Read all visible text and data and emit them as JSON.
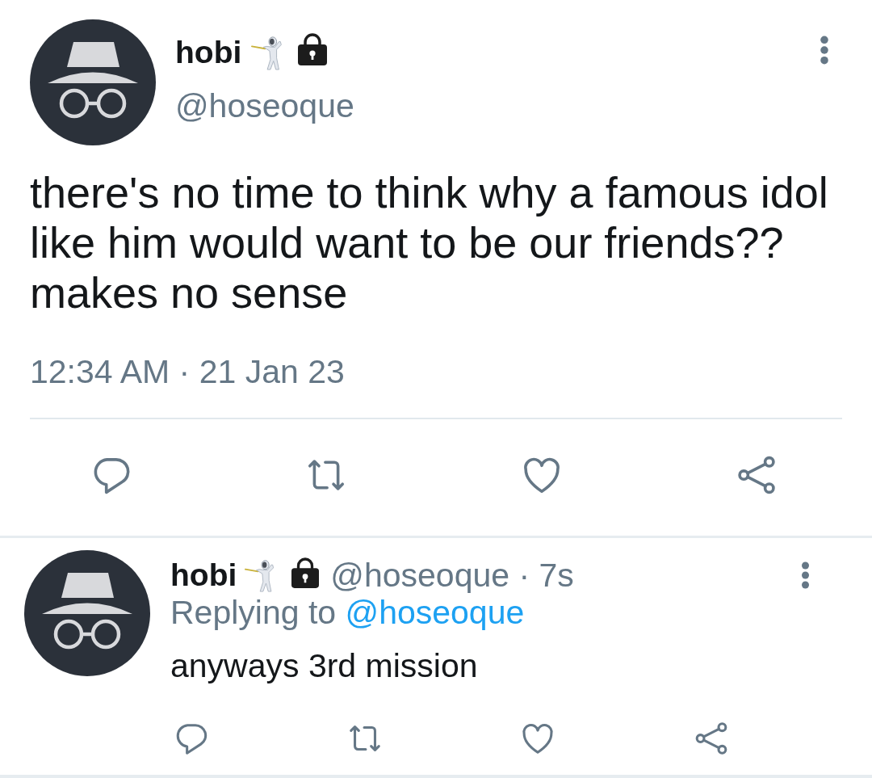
{
  "tweet": {
    "author": {
      "name": "hobi",
      "handle": "@hoseoque"
    },
    "text": "there's no time to think why a famous idol like him would want to be our friends?? makes no sense",
    "timestamp": "12:34 AM · 21 Jan 23"
  },
  "reply": {
    "author": {
      "name": "hobi"
    },
    "meta": "@hoseoque · 7s",
    "replying_to": {
      "label": "Replying to",
      "handle": "@hoseoque"
    },
    "text": "anyways 3rd mission"
  }
}
